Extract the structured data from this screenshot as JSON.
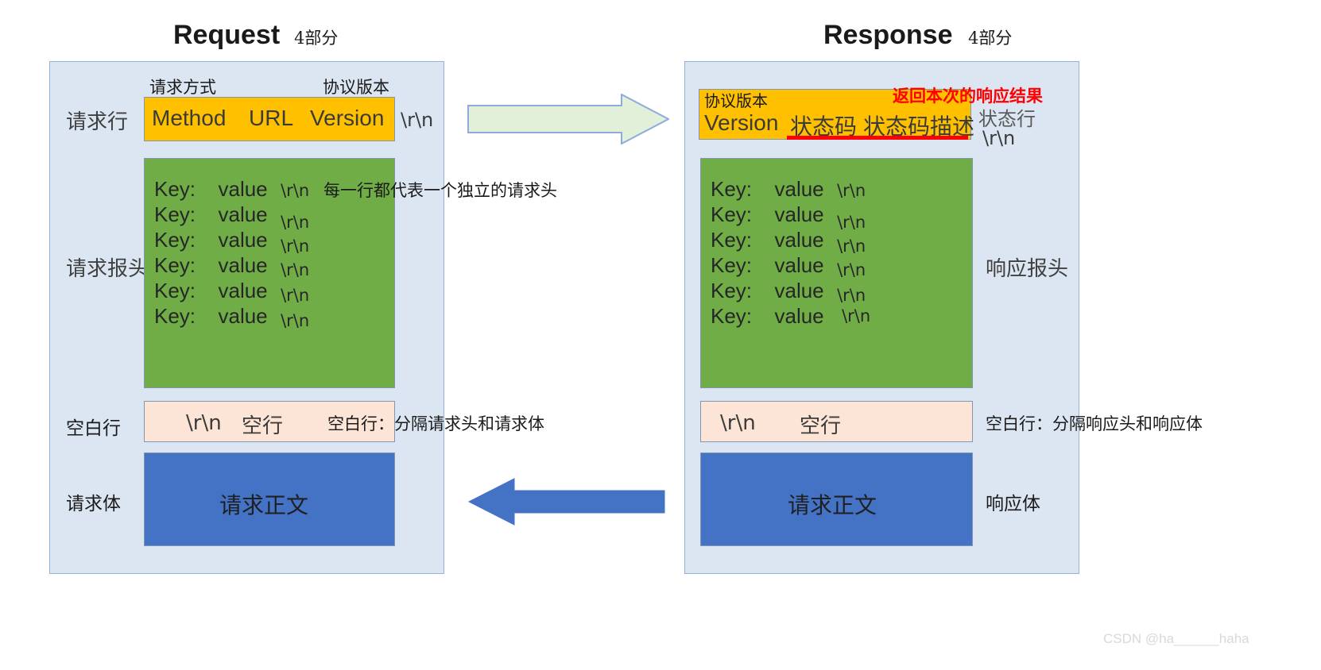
{
  "request": {
    "title": "Request",
    "title_note": "4部分",
    "sections": {
      "line": "请求行",
      "headers": "请求报头",
      "blank": "空白行",
      "body": "请求体"
    },
    "request_line": {
      "label_method": "请求方式",
      "label_version": "协议版本",
      "method": "Method",
      "url": "URL",
      "version": "Version",
      "crlf": "\\r\\n"
    },
    "headers": {
      "rows": [
        {
          "key": "Key:",
          "value": "value",
          "crlf": "\\r\\n"
        },
        {
          "key": "Key:",
          "value": "value",
          "crlf": "\\r\\n"
        },
        {
          "key": "Key:",
          "value": "value",
          "crlf": "\\r\\n"
        },
        {
          "key": "Key:",
          "value": "value",
          "crlf": "\\r\\n"
        },
        {
          "key": "Key:",
          "value": "value",
          "crlf": "\\r\\n"
        },
        {
          "key": "Key:",
          "value": "value",
          "crlf": "\\r\\n"
        }
      ],
      "note": "每一行都代表一个独立的请求头"
    },
    "blank_line": {
      "crlf": "\\r\\n",
      "text": "空行",
      "note": "空白行：分隔请求头和请求体"
    },
    "body": {
      "text": "请求正文"
    }
  },
  "response": {
    "title": "Response",
    "title_note": "4部分",
    "status_line": {
      "label_version": "协议版本",
      "note_red": "返回本次的响应结果",
      "version": "Version",
      "status_code": "状态码",
      "status_desc": "状态码描述",
      "side_label": "状态行",
      "crlf": "\\r\\n"
    },
    "headers": {
      "rows": [
        {
          "key": "Key:",
          "value": "value",
          "crlf": "\\r\\n"
        },
        {
          "key": "Key:",
          "value": "value",
          "crlf": "\\r\\n"
        },
        {
          "key": "Key:",
          "value": "value",
          "crlf": "\\r\\n"
        },
        {
          "key": "Key:",
          "value": "value",
          "crlf": "\\r\\n"
        },
        {
          "key": "Key:",
          "value": "value",
          "crlf": "\\r\\n"
        },
        {
          "key": "Key:",
          "value": "value",
          "crlf": "\\r\\n"
        }
      ],
      "side_label": "响应报头"
    },
    "blank_line": {
      "crlf": "\\r\\n",
      "text": "空行",
      "note": "空白行：分隔响应头和响应体"
    },
    "body": {
      "text": "请求正文",
      "side_label": "响应体"
    }
  },
  "arrows": {
    "request_arrow": "right-arrow",
    "response_arrow": "left-arrow"
  },
  "watermark": "CSDN @ha______haha",
  "colors": {
    "panel_fill": "#dce6f2",
    "panel_border": "#95b3d7",
    "line_fill": "#ffc000",
    "headers_fill": "#70ad47",
    "blank_fill": "#fce4d6",
    "body_fill": "#4472c4",
    "accent_red": "#ff0000",
    "arrow_green": "#e2efd9",
    "arrow_blue": "#4472c4"
  }
}
